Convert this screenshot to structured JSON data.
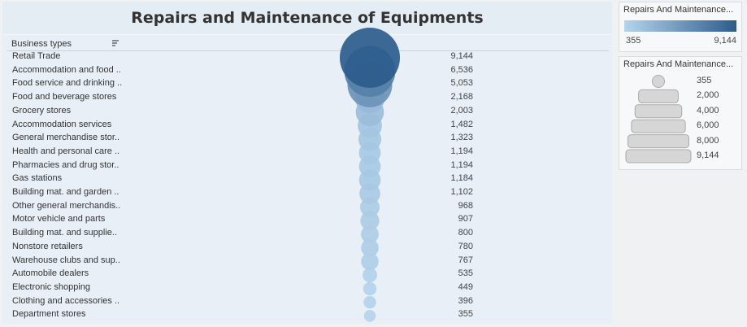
{
  "title": "Repairs and Maintenance of Equipments",
  "column_header": "Business types",
  "legends": {
    "color": {
      "title": "Repairs And Maintenance...",
      "min_label": "355",
      "max_label": "9,144",
      "color_low": "#b4d4ec",
      "color_high": "#2d5c8c"
    },
    "size": {
      "title": "Repairs And Maintenance...",
      "entries": [
        {
          "label": "355",
          "value": 355
        },
        {
          "label": "2,000",
          "value": 2000
        },
        {
          "label": "4,000",
          "value": 4000
        },
        {
          "label": "6,000",
          "value": 6000
        },
        {
          "label": "8,000",
          "value": 8000
        },
        {
          "label": "9,144",
          "value": 9144
        }
      ]
    }
  },
  "chart_data": {
    "type": "scatter",
    "title": "Repairs and Maintenance of Equipments",
    "mark": "circle sized and colored by value",
    "categories": [
      "Retail Trade",
      "Accommodation and food ..",
      "Food service and drinking ..",
      "Food and beverage stores",
      "Grocery stores",
      "Accommodation services",
      "General merchandise stor..",
      "Health and personal care ..",
      "Pharmacies and drug stor..",
      "Gas stations",
      "Building mat. and garden ..",
      "Other general merchandis..",
      "Motor vehicle and parts",
      "Building mat. and supplie..",
      "Nonstore retailers",
      "Warehouse clubs and sup..",
      "Automobile dealers",
      "Electronic shopping",
      "Clothing and accessories ..",
      "Department stores"
    ],
    "values": [
      9144,
      6536,
      5053,
      2168,
      2003,
      1482,
      1323,
      1194,
      1194,
      1184,
      1102,
      968,
      907,
      800,
      780,
      767,
      535,
      449,
      396,
      355
    ],
    "value_labels": [
      "9,144",
      "6,536",
      "5,053",
      "2,168",
      "2,003",
      "1,482",
      "1,323",
      "1,194",
      "1,194",
      "1,184",
      "1,102",
      "968",
      "907",
      "800",
      "780",
      "767",
      "535",
      "449",
      "396",
      "355"
    ],
    "color_range": [
      355,
      9144
    ],
    "sort": "descending"
  }
}
